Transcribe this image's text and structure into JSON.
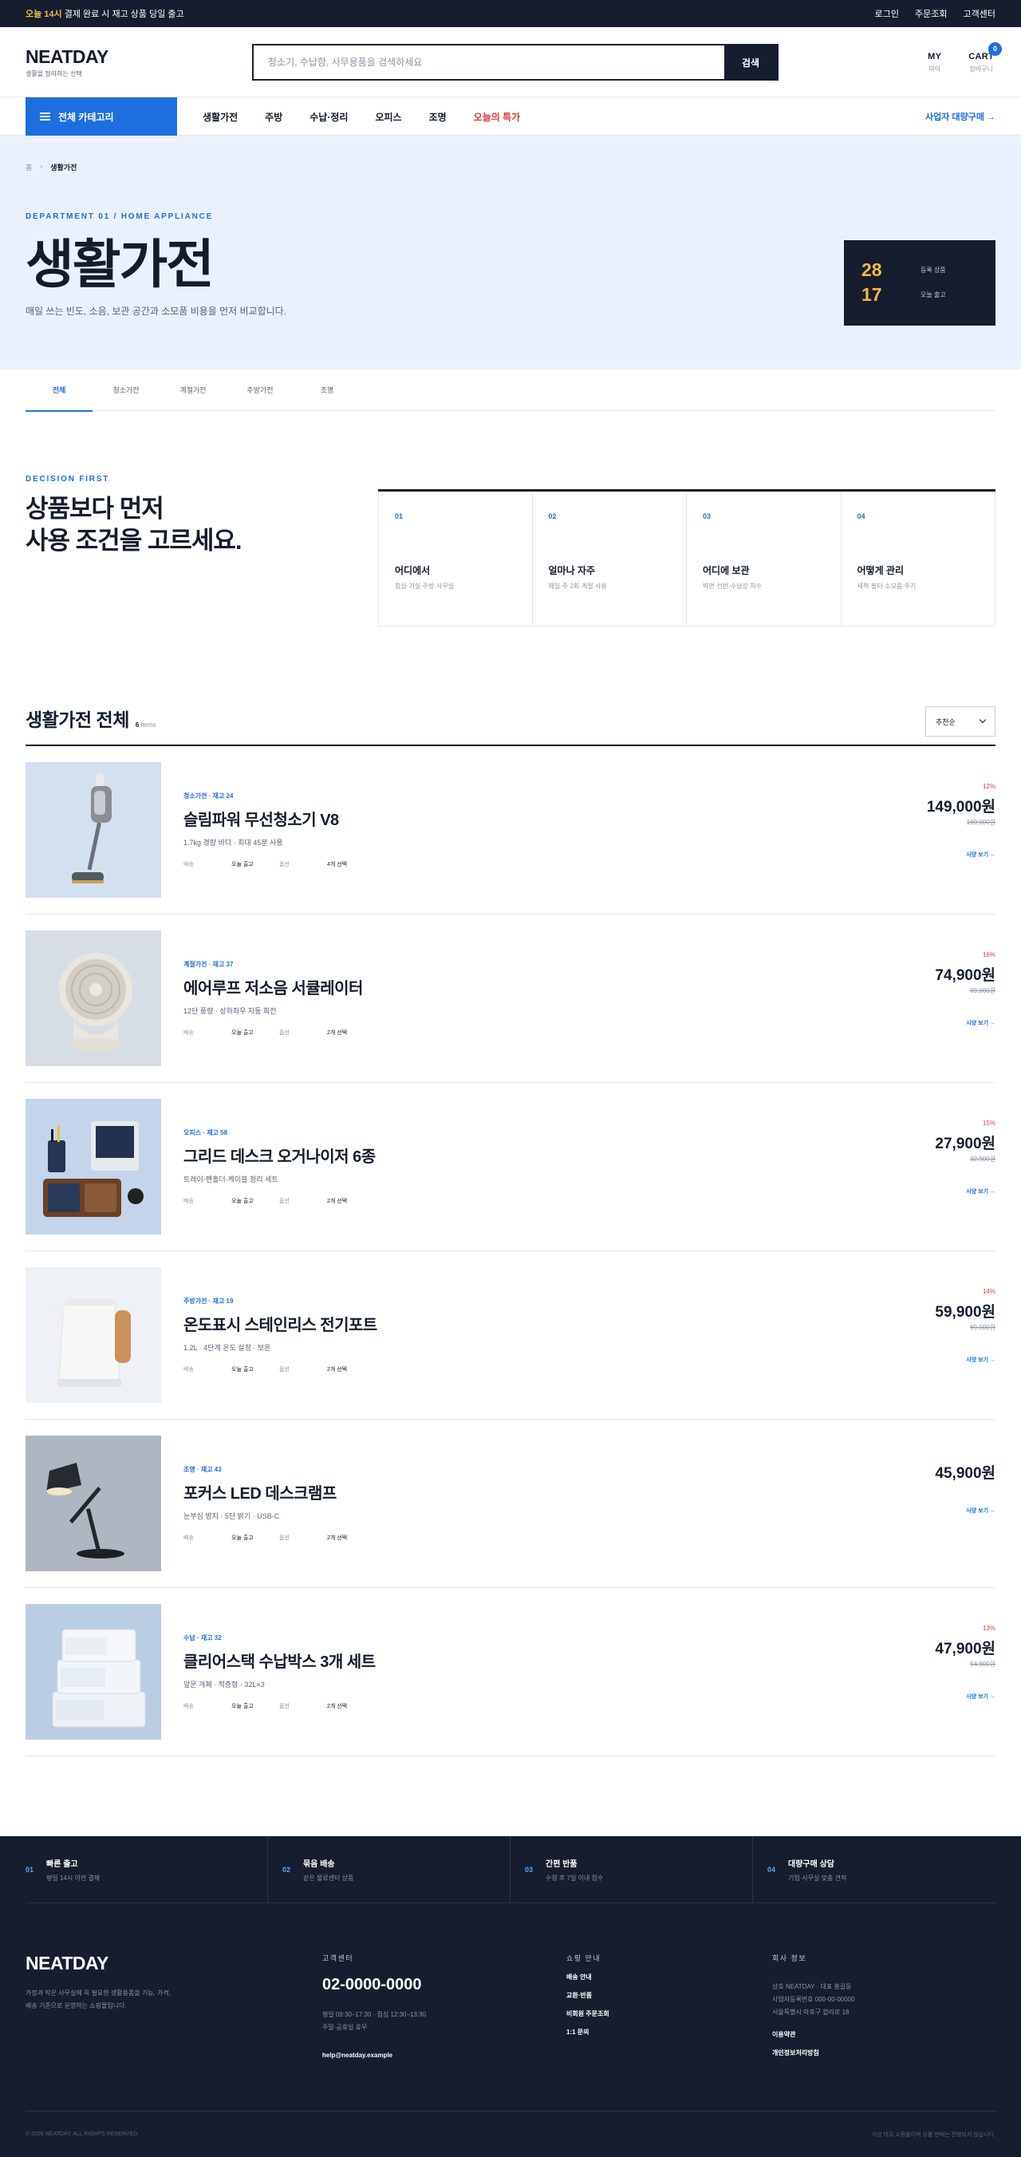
{
  "topbar": {
    "highlight": "오늘 14시",
    "message": "결제 완료 시 재고 상품 당일 출고",
    "links": [
      "로그인",
      "주문조회",
      "고객센터"
    ]
  },
  "header": {
    "logo": "NEATDAY",
    "tagline": "생활을 정리하는 선택",
    "search_placeholder": "청소기, 수납함, 사무용품을 검색하세요",
    "search_button": "검색",
    "my_label": "MY",
    "my_sub": "마이",
    "cart_label": "CART",
    "cart_sub": "장바구니",
    "cart_count": "0"
  },
  "nav": {
    "all_categories": "전체 카테고리",
    "items": [
      "생활가전",
      "주방",
      "수납·정리",
      "오피스",
      "조명",
      "오늘의 특가"
    ],
    "business": "사업자 대량구매 →"
  },
  "hero": {
    "crumb_home": "홈",
    "crumb_sep": "›",
    "crumb_current": "생활가전",
    "dept": "DEPARTMENT 01 / HOME APPLIANCE",
    "title": "생활가전",
    "desc": "매일 쓰는 빈도, 소음, 보관 공간과 소모품 비용을 먼저 비교합니다.",
    "stats": [
      {
        "value": "28",
        "label": "등록 상품"
      },
      {
        "value": "17",
        "label": "오늘 출고"
      }
    ]
  },
  "tabs": [
    "전체",
    "청소가전",
    "계절가전",
    "주방가전",
    "조명"
  ],
  "decision": {
    "eyebrow": "DECISION FIRST",
    "title_line1": "상품보다 먼저",
    "title_line2": "사용 조건을 고르세요.",
    "cells": [
      {
        "num": "01",
        "label": "어디에서",
        "sub": "침실·거실·주방·사무실"
      },
      {
        "num": "02",
        "label": "얼마나 자주",
        "sub": "매일·주 2회·계절 사용"
      },
      {
        "num": "03",
        "label": "어디에 보관",
        "sub": "벽면·선반·수납장 치수"
      },
      {
        "num": "04",
        "label": "어떻게 관리",
        "sub": "세척·필터·소모품 주기"
      }
    ]
  },
  "list": {
    "title": "생활가전 전체",
    "count": "6",
    "count_suffix": "items",
    "sort": "추천순"
  },
  "products": [
    {
      "cat": "청소가전 · 재고 24",
      "name": "슬림파워 무선청소기 V8",
      "desc": "1.7kg 경량 바디 · 최대 45분 사용",
      "meta": [
        "배송",
        "오늘 출고",
        "옵션",
        "4개 선택"
      ],
      "discount": "12%",
      "price": "149,000원",
      "orig": "169,000원",
      "more": "사양 보기 →"
    },
    {
      "cat": "계절가전 · 재고 37",
      "name": "에어루프 저소음 서큘레이터",
      "desc": "12단 풍량 · 상하좌우 자동 회전",
      "meta": [
        "배송",
        "오늘 출고",
        "옵션",
        "2개 선택"
      ],
      "discount": "16%",
      "price": "74,900원",
      "orig": "89,000원",
      "more": "사양 보기 →"
    },
    {
      "cat": "오피스 · 재고 58",
      "name": "그리드 데스크 오거나이저 6종",
      "desc": "트레이·펜홀더·케이블 정리 세트",
      "meta": [
        "배송",
        "오늘 출고",
        "옵션",
        "2개 선택"
      ],
      "discount": "15%",
      "price": "27,900원",
      "orig": "32,900원",
      "more": "사양 보기 →"
    },
    {
      "cat": "주방가전 · 재고 19",
      "name": "온도표시 스테인리스 전기포트",
      "desc": "1.2L · 4단계 온도 설정 · 보온",
      "meta": [
        "배송",
        "오늘 출고",
        "옵션",
        "2개 선택"
      ],
      "discount": "14%",
      "price": "59,900원",
      "orig": "69,900원",
      "more": "사양 보기 →"
    },
    {
      "cat": "조명 · 재고 43",
      "name": "포커스 LED 데스크램프",
      "desc": "눈부심 방지 · 5단 밝기 · USB-C",
      "meta": [
        "배송",
        "오늘 출고",
        "옵션",
        "2개 선택"
      ],
      "discount": "",
      "price": "45,900원",
      "orig": "",
      "more": "사양 보기 →"
    },
    {
      "cat": "수납 · 재고 32",
      "name": "클리어스택 수납박스 3개 세트",
      "desc": "앞문 개폐 · 적층형 · 32L×3",
      "meta": [
        "배송",
        "오늘 출고",
        "옵션",
        "2개 선택"
      ],
      "discount": "13%",
      "price": "47,900원",
      "orig": "54,900원",
      "more": "사양 보기 →"
    }
  ],
  "footer": {
    "services": [
      {
        "num": "01",
        "title": "빠른 출고",
        "sub": "평일 14시 이전 결제"
      },
      {
        "num": "02",
        "title": "묶음 배송",
        "sub": "같은 물류센터 상품"
      },
      {
        "num": "03",
        "title": "간편 반품",
        "sub": "수령 후 7일 이내 접수"
      },
      {
        "num": "04",
        "title": "대량구매 상담",
        "sub": "기업·사무실 맞춤 견적"
      }
    ],
    "logo": "NEATDAY",
    "desc": "가정과 작은 사무실에 꼭 필요한 생활용품을 기능, 가격, 배송 기준으로 운영하는 쇼핑몰입니다.",
    "cs_head": "고객센터",
    "phone": "02-0000-0000",
    "hours1": "평일 09:30–17:30 · 점심 12:30–13:30",
    "hours2": "주말·공휴일 휴무",
    "email": "help@neatday.example",
    "shop_head": "쇼핑 안내",
    "shop_links": [
      "배송 안내",
      "교환·반품",
      "비회원 주문조회",
      "1:1 문의"
    ],
    "co_head": "회사 정보",
    "co1": "상호 NEATDAY · 대표 홍길동",
    "co2": "사업자등록번호 000-00-00000",
    "co3": "서울특별시 마포구 합리로 18",
    "terms": "이용약관",
    "privacy": "개인정보처리방침",
    "copyright": "© 2026 NEATDAY. ALL RIGHTS RESERVED.",
    "notice": "가상 데모 쇼핑몰이며 상품 판매는 진행되지 않습니다."
  }
}
